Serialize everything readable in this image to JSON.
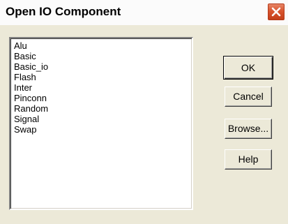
{
  "window": {
    "title": "Open IO Component",
    "close_icon": "close-icon"
  },
  "list": {
    "items": [
      "Alu",
      "Basic",
      "Basic_io",
      "Flash",
      "Inter",
      "Pinconn",
      "Random",
      "Signal",
      "Swap"
    ]
  },
  "buttons": {
    "ok": "OK",
    "cancel": "Cancel",
    "browse": "Browse...",
    "help": "Help"
  },
  "colors": {
    "dialog_bg": "#ece9d8",
    "close_red": "#d9552f"
  }
}
